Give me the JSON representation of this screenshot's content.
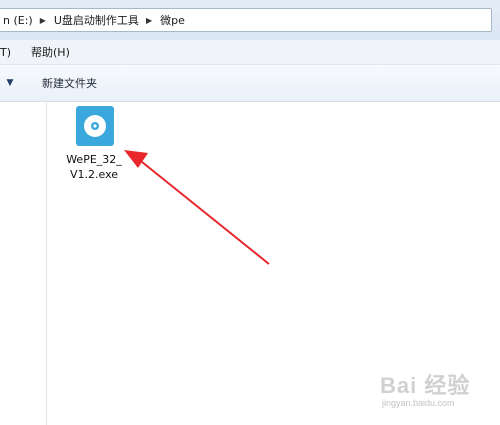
{
  "address_bar": {
    "crumbs": [
      "n (E:)",
      "U盘启动制作工具",
      "微pe"
    ],
    "separator": "▶"
  },
  "menu": {
    "items": [
      "T)",
      "帮助(H)"
    ]
  },
  "toolbar": {
    "dropdown_glyph": "▼",
    "new_folder_label": "新建文件夹"
  },
  "files": [
    {
      "name_line1": "WePE_32_",
      "name_line2": "V1.2.exe",
      "icon": "disc-installer-icon",
      "icon_color": "#3aa8dc"
    }
  ],
  "annotation": {
    "arrow_color": "#e8262b"
  },
  "watermark": {
    "text": "Bai 经验",
    "url": "jingyan.baidu.com"
  }
}
